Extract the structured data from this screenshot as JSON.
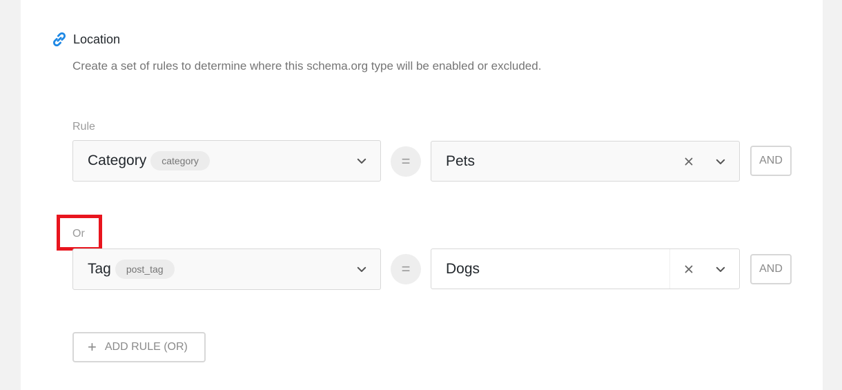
{
  "section": {
    "title": "Location",
    "description": "Create a set of rules to determine where this schema.org type will be enabled or excluded."
  },
  "rules": [
    {
      "group_label": "Rule",
      "field": {
        "label": "Category",
        "slug": "category"
      },
      "operator": "=",
      "value": "Pets",
      "and_label": "AND"
    },
    {
      "group_label": "Or",
      "field": {
        "label": "Tag",
        "slug": "post_tag"
      },
      "operator": "=",
      "value": "Dogs",
      "and_label": "AND"
    }
  ],
  "add_rule_label": "ADD RULE (OR)",
  "colors": {
    "accent": "#1e88e5",
    "highlight": "#e8151e"
  },
  "icons": {
    "section": "link-icon",
    "select": "chevron-down-icon",
    "clear": "close-icon",
    "add": "plus-icon"
  }
}
